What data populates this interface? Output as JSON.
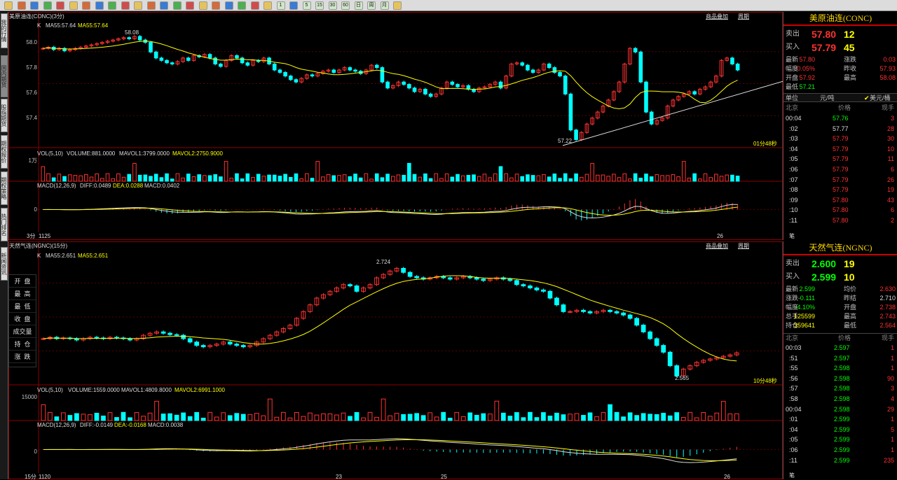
{
  "toolbar": {
    "icons": [
      "home-icon",
      "back-icon",
      "forward-icon",
      "refresh-icon",
      "zoom-in-icon",
      "zoom-out-icon",
      "zoom-reset-icon",
      "edit-icon",
      "draw-icon",
      "fav-icon",
      "stats-icon",
      "table-icon",
      "chart-icon",
      "page-icon",
      "page-icon",
      "page-icon",
      "page-icon",
      "page-icon",
      "page-icon",
      "page-icon",
      "page-icon",
      "1",
      "down-icon",
      "5",
      "15",
      "30",
      "60",
      "日",
      "周",
      "月",
      "menu-icon"
    ]
  },
  "sidetabs": [
    "我的行情",
    "国内期货",
    "股指期货",
    "期权报价",
    "期权策略",
    "热门排名",
    "新闻资讯"
  ],
  "top": {
    "title": "美原油连(CONC)(3分)",
    "links": [
      "商品叠加",
      "周期"
    ],
    "kline_label": "K",
    "ma_label": "MA55:57.64",
    "ma2_label": "MA55:57.64",
    "yticks": [
      "58.0",
      "57.8",
      "57.6",
      "57.4"
    ],
    "high_label": "58.08",
    "low_label": "57.22",
    "time_label": "01分48秒",
    "vol_label": "VOL(5,10)",
    "vol_value": "VOLUME:881.0000",
    "vol_ma1": "MAVOL1:3799.0000",
    "vol_ma2": "MAVOL2:2750.9000",
    "vol_tick": "1万",
    "macd_label": "MACD(12,26,9)",
    "diff": "DIFF:0.0489",
    "dea": "DEA:0.0288",
    "macd": "MACD:0.0402",
    "macd_tick": "0",
    "period": "3分",
    "date_left": "1125",
    "date_right": "26",
    "chart_data": {
      "type": "candlestick",
      "series": [
        {
          "name": "close",
          "values": [
            57.98,
            57.99,
            57.97,
            57.98,
            57.96,
            57.97,
            57.98,
            57.99,
            58.0,
            58.01,
            58.02,
            58.03,
            58.04,
            58.05,
            58.06,
            58.07,
            58.06,
            58.08,
            58.05,
            58.03,
            57.95,
            57.9,
            57.88,
            57.86,
            57.85,
            57.87,
            57.9,
            57.88,
            57.92,
            57.91,
            57.93,
            57.9,
            57.85,
            57.83,
            57.88,
            57.92,
            57.9,
            57.86,
            57.84,
            57.88,
            57.87,
            57.9,
            57.85,
            57.8,
            57.78,
            57.75,
            57.72,
            57.7,
            57.73,
            57.76,
            57.75,
            57.77,
            57.79,
            57.8,
            57.78,
            57.8,
            57.82,
            57.8,
            57.79,
            57.77,
            57.8,
            57.84,
            57.82,
            57.7,
            57.65,
            57.67,
            57.7,
            57.68,
            57.65,
            57.62,
            57.64,
            57.6,
            57.58,
            57.6,
            57.65,
            57.7,
            57.68,
            57.66,
            57.67,
            57.64,
            57.62,
            57.65,
            57.66,
            57.68,
            57.7,
            57.65,
            57.75,
            57.85,
            57.86,
            57.84,
            57.8,
            57.78,
            57.8,
            57.85,
            57.82,
            57.78,
            57.75,
            57.6,
            57.3,
            57.22,
            57.28,
            57.35,
            57.4,
            57.45,
            57.5,
            57.55,
            57.62,
            57.7,
            57.85,
            57.98,
            57.95,
            57.7,
            57.45,
            57.35,
            57.38,
            57.4,
            57.5,
            57.55,
            57.58,
            57.6,
            57.62,
            57.6,
            57.64,
            57.66,
            57.7,
            57.75,
            57.88,
            57.9,
            57.85,
            57.8
          ]
        }
      ],
      "ylim": [
        57.2,
        58.15
      ]
    }
  },
  "bottom": {
    "title": "天然气连(NGNC)(15分)",
    "links": [
      "商品叠加",
      "周期"
    ],
    "kline_label": "K",
    "ma_label": "MA55:2.651",
    "ma2_label": "MA55:2.651",
    "high_label": "2.724",
    "low_label": "2.565",
    "time_label": "10分48秒",
    "vol_label": "VOL(5,10)",
    "vol_value": "VOLUME:1559.0000",
    "vol_ma1": "MAVOL1:4809.8000",
    "vol_ma2": "MAVOL2:6991.1000",
    "vol_tick": "15000",
    "macd_label": "MACD(12,26,9)",
    "diff": "DIFF:-0.0149",
    "dea": "DEA:-0.0168",
    "macd": "MACD:0.0038",
    "macd_tick": "0",
    "period": "15分",
    "date_left": "1120",
    "date_mid1": "23",
    "date_mid2": "25",
    "date_right": "26",
    "cursor_panel": [
      "开",
      "盘",
      "最",
      "高",
      "最",
      "低",
      "收",
      "盘",
      "成交量",
      "持",
      "仓",
      "涨",
      "跌",
      "幅",
      "度"
    ],
    "chart_data": {
      "type": "candlestick",
      "series": [
        {
          "name": "close",
          "values": [
            2.62,
            2.622,
            2.62,
            2.621,
            2.62,
            2.618,
            2.62,
            2.622,
            2.621,
            2.62,
            2.622,
            2.621,
            2.62,
            2.618,
            2.62,
            2.625,
            2.628,
            2.63,
            2.628,
            2.626,
            2.625,
            2.62,
            2.615,
            2.61,
            2.608,
            2.61,
            2.612,
            2.615,
            2.612,
            2.61,
            2.608,
            2.61,
            2.615,
            2.62,
            2.625,
            2.63,
            2.635,
            2.64,
            2.65,
            2.66,
            2.67,
            2.68,
            2.685,
            2.69,
            2.695,
            2.7,
            2.698,
            2.69,
            2.695,
            2.7,
            2.71,
            2.715,
            2.72,
            2.724,
            2.718,
            2.712,
            2.71,
            2.708,
            2.71,
            2.712,
            2.71,
            2.708,
            2.71,
            2.712,
            2.71,
            2.708,
            2.706,
            2.708,
            2.71,
            2.708,
            2.706,
            2.7,
            2.698,
            2.695,
            2.692,
            2.69,
            2.68,
            2.67,
            2.66,
            2.66,
            2.662,
            2.66,
            2.658,
            2.66,
            2.662,
            2.66,
            2.658,
            2.655,
            2.65,
            2.64,
            2.63,
            2.62,
            2.61,
            2.6,
            2.58,
            2.565,
            2.575,
            2.58,
            2.585,
            2.588,
            2.59,
            2.592,
            2.594,
            2.596,
            2.599
          ]
        }
      ],
      "ylim": [
        2.56,
        2.74
      ]
    }
  },
  "conc": {
    "name": "美原油连(CONC)",
    "sell_label": "卖出",
    "sell_price": "57.80",
    "sell_vol": "12",
    "buy_label": "买入",
    "buy_price": "57.79",
    "buy_vol": "45",
    "stats": [
      [
        "最新",
        "57.80",
        "涨跌",
        "0.03"
      ],
      [
        "幅度",
        "0.05%",
        "昨收",
        "57.93"
      ],
      [
        "开盘",
        "57.92",
        "最高",
        "58.08"
      ],
      [
        "最低",
        "57.21",
        "",
        ""
      ]
    ],
    "unit_label": "单位",
    "unit_val": "元/吨",
    "unit_opt": "美元/桶",
    "ticks_head": [
      "北京",
      "价格",
      "现手"
    ],
    "ticks": [
      [
        "00:04",
        "57.76",
        "3"
      ],
      [
        ":02",
        "57.77",
        "28"
      ],
      [
        ":03",
        "57.79",
        "30"
      ],
      [
        ":04",
        "57.79",
        "10"
      ],
      [
        ":05",
        "57.79",
        "11"
      ],
      [
        ":06",
        "57.79",
        "6"
      ],
      [
        ":07",
        "57.79",
        "26"
      ],
      [
        ":08",
        "57.79",
        "19"
      ],
      [
        ":09",
        "57.80",
        "43"
      ],
      [
        ":10",
        "57.80",
        "6"
      ],
      [
        ":11",
        "57.80",
        "2"
      ]
    ],
    "note": "笔"
  },
  "ngnc": {
    "name": "天然气连(NGNC)",
    "sell_label": "卖出",
    "sell_price": "2.600",
    "sell_vol": "19",
    "buy_label": "买入",
    "buy_price": "2.599",
    "buy_vol": "10",
    "stats": [
      [
        "最新",
        "2.599",
        "均价",
        "2.630"
      ],
      [
        "涨跌",
        "-0.111",
        "昨结",
        "2.710"
      ],
      [
        "幅度",
        "-4.10%",
        "开盘",
        "2.738"
      ],
      [
        "总手",
        "125599",
        "最高",
        "2.743"
      ],
      [
        "持仓",
        "359641",
        "最低",
        "2.564"
      ]
    ],
    "ticks_head": [
      "北京",
      "价格",
      "现手"
    ],
    "ticks": [
      [
        "00:03",
        "2.597",
        "1"
      ],
      [
        ":51",
        "2.597",
        "1"
      ],
      [
        ":55",
        "2.598",
        "1"
      ],
      [
        ":56",
        "2.598",
        "90"
      ],
      [
        ":57",
        "2.598",
        "3"
      ],
      [
        ":58",
        "2.598",
        "4"
      ],
      [
        "00:04",
        "2.598",
        "29"
      ],
      [
        ":01",
        "2.599",
        "1"
      ],
      [
        ":04",
        "2.599",
        "5"
      ],
      [
        ":05",
        "2.599",
        "1"
      ],
      [
        ":06",
        "2.599",
        "1"
      ],
      [
        ":11",
        "2.599",
        "235"
      ]
    ],
    "note": "笔"
  },
  "colors": {
    "up": "#ff3232",
    "down": "#00ffff",
    "ma": "#ffff00",
    "grid": "#8b0000",
    "frame": "#8b0000"
  }
}
